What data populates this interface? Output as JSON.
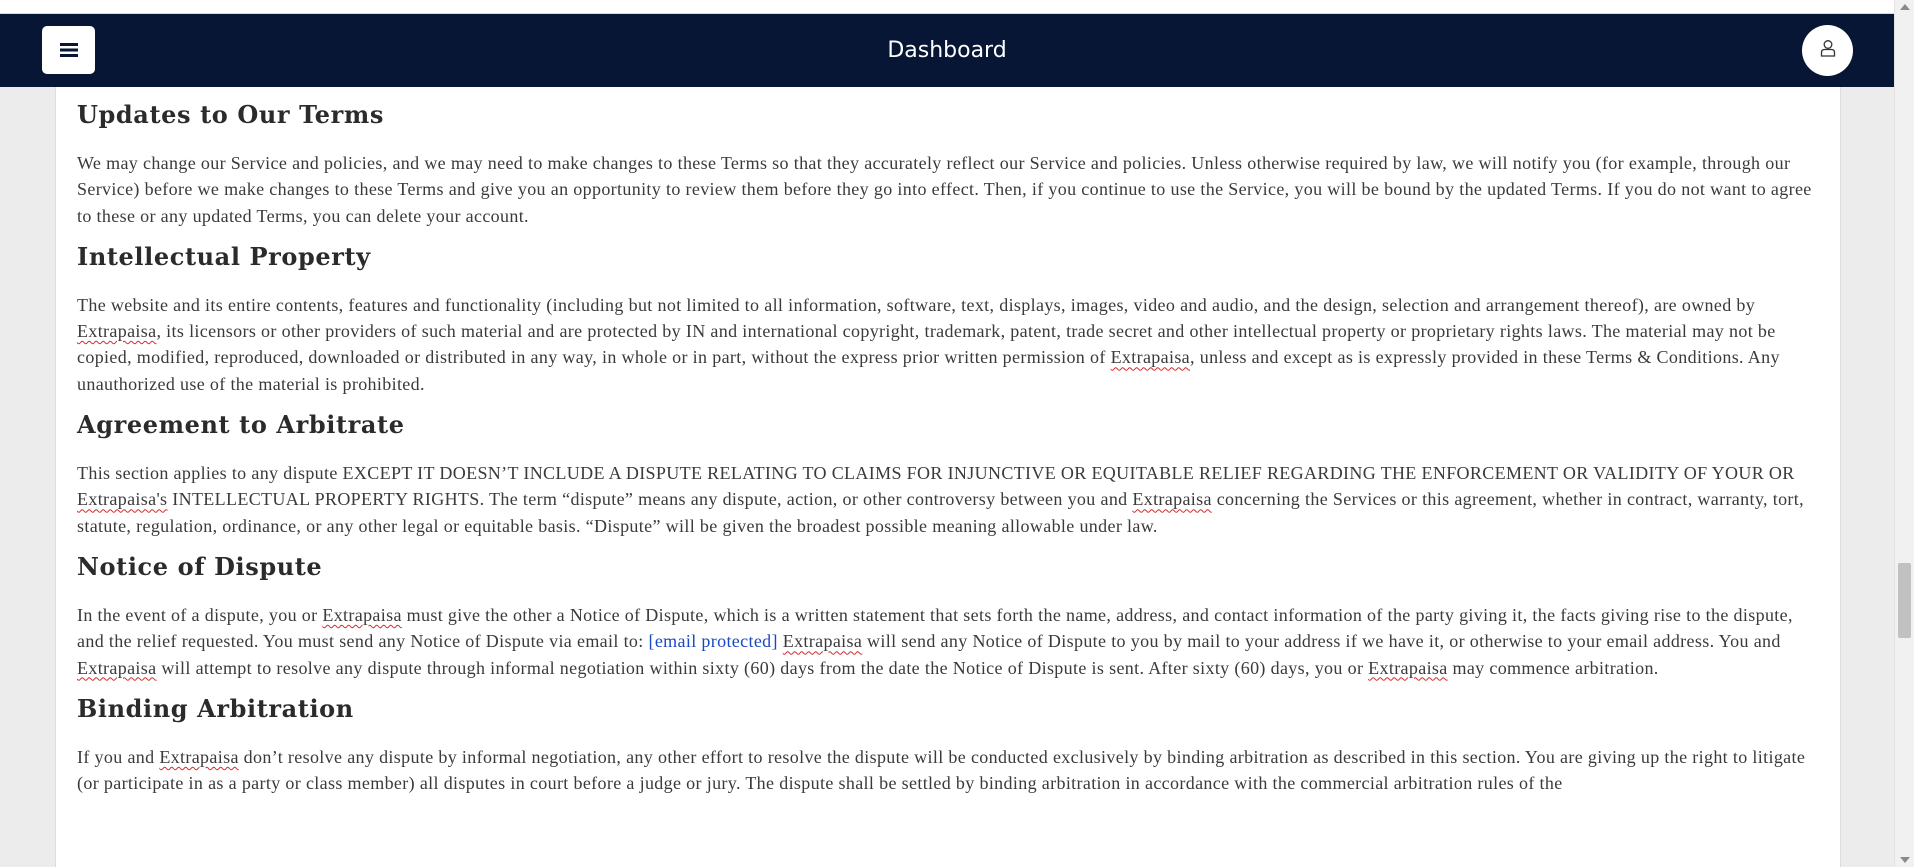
{
  "navbar": {
    "title": "Dashboard",
    "menu_icon": "hamburger-menu-icon",
    "user_icon": "user-icon",
    "background": "#061634"
  },
  "sections": [
    {
      "heading": "Updates to Our Terms",
      "text_parts": [
        "We may change our Service and policies, and we may need to make changes to these Terms so that they accurately reflect our Service and policies. Unless otherwise required by law, we will notify you (for example, through our Service) before we make changes to these Terms and give you an opportunity to review them before they go into effect. Then, if you continue to use the Service, you will be bound by the updated Terms. If you do not want to agree to these or any updated Terms, you can delete your account."
      ]
    },
    {
      "heading": "Intellectual Property",
      "text_parts": [
        "The website and its entire contents, features and functionality (including but not limited to all information, software, text, displays, images, video and audio, and the design, selection and arrangement thereof), are owned by ",
        "Extrapaisa",
        ", its licensors or other providers of such material and are protected by IN and international copyright, trademark, patent, trade secret and other intellectual property or proprietary rights laws. The material may not be copied, modified, reproduced, downloaded or distributed in any way, in whole or in part, without the express prior written permission of ",
        "Extrapaisa",
        ", unless and except as is expressly provided in these Terms & Conditions. Any unauthorized use of the material is prohibited."
      ]
    },
    {
      "heading": "Agreement to Arbitrate",
      "text_parts": [
        "This section applies to any dispute EXCEPT IT DOESN’T INCLUDE A DISPUTE RELATING TO CLAIMS FOR INJUNCTIVE OR EQUITABLE RELIEF REGARDING THE ENFORCEMENT OR VALIDITY OF YOUR OR ",
        "Extrapaisa's",
        " INTELLECTUAL PROPERTY RIGHTS. The term “dispute” means any dispute, action, or other controversy between you and ",
        "Extrapaisa",
        " concerning the Services or this agreement, whether in contract, warranty, tort, statute, regulation, ordinance, or any other legal or equitable basis. “Dispute” will be given the broadest possible meaning allowable under law."
      ]
    },
    {
      "heading": "Notice of Dispute",
      "text_parts": [
        "In the event of a dispute, you or ",
        "Extrapaisa",
        " must give the other a Notice of Dispute, which is a written statement that sets forth the name, address, and contact information of the party giving it, the facts giving rise to the dispute, and the relief requested. You must send any Notice of Dispute via email to: ",
        "[email protected]",
        " ",
        "Extrapaisa",
        " will send any Notice of Dispute to you by mail to your address if we have it, or otherwise to your email address. You and ",
        "Extrapaisa",
        " will attempt to resolve any dispute through informal negotiation within sixty (60) days from the date the Notice of Dispute is sent. After sixty (60) days, you or ",
        "Extrapaisa",
        " may commence arbitration."
      ]
    },
    {
      "heading": "Binding Arbitration",
      "text_parts": [
        "If you and ",
        "Extrapaisa",
        " don’t resolve any dispute by informal negotiation, any other effort to resolve the dispute will be conducted exclusively by binding arbitration as described in this section. You are giving up the right to litigate (or participate in as a party or class member) all disputes in court before a judge or jury. The dispute shall be settled by binding arbitration in accordance with the commercial arbitration rules of the"
      ]
    }
  ],
  "colors": {
    "link": "#1a47c4",
    "heading": "#2b2b2b",
    "body_text": "#3a3a3a"
  }
}
